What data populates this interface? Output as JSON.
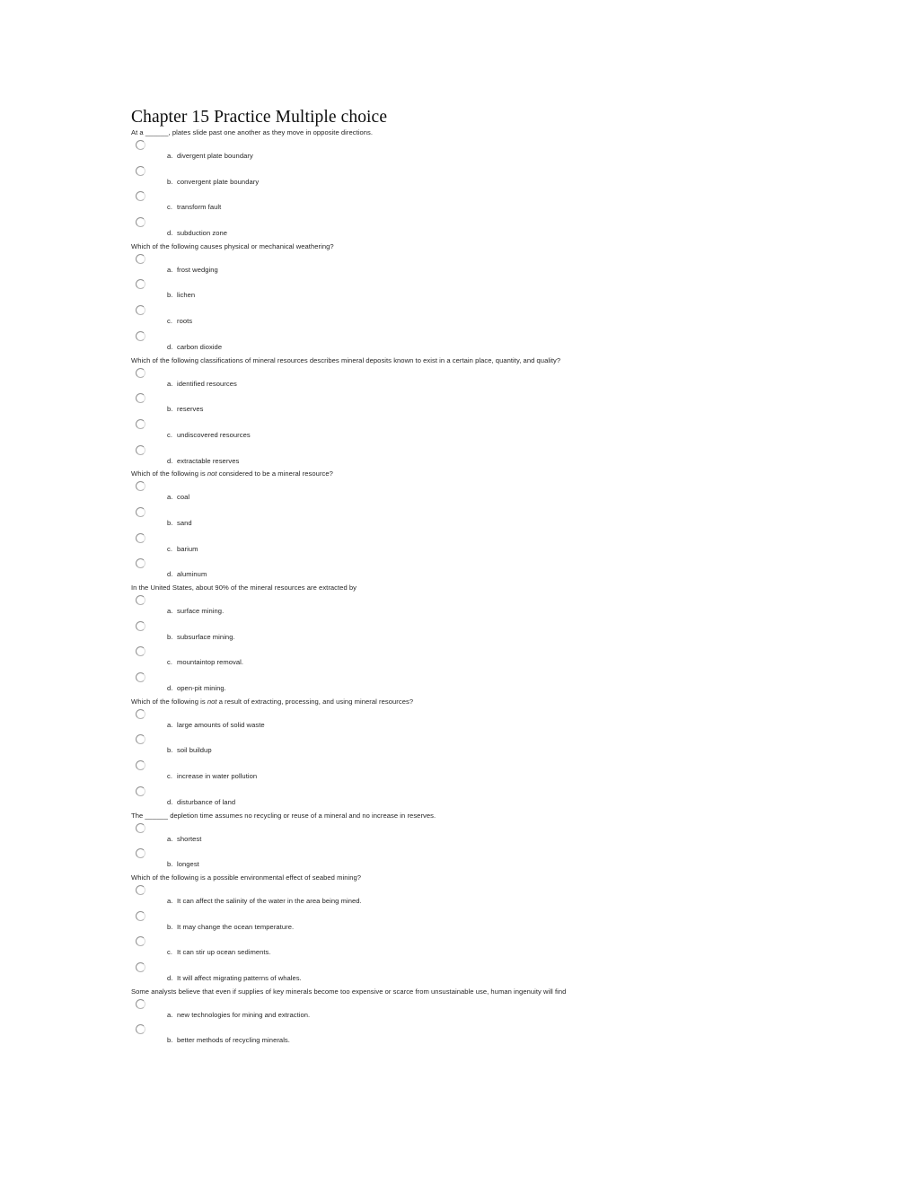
{
  "document": {
    "title": "Chapter 15 Practice Multiple choice",
    "radio_icon": "radio-unchecked-icon",
    "colors": {
      "page_background": "#ffffff",
      "text": "#262626",
      "title": "#0d0d0d",
      "radio_border": "#b0b0b0"
    }
  },
  "questions": [
    {
      "id": "q1",
      "text_parts": [
        {
          "type": "plain",
          "text": "At a ______, plates slide past one another as they move in opposite directions."
        }
      ],
      "options": [
        {
          "letter": "a.",
          "text": "divergent plate boundary"
        },
        {
          "letter": "b.",
          "text": "convergent plate boundary"
        },
        {
          "letter": "c.",
          "text": "transform fault"
        },
        {
          "letter": "d.",
          "text": "subduction zone"
        }
      ]
    },
    {
      "id": "q2",
      "text_parts": [
        {
          "type": "plain",
          "text": "Which of the following causes physical or mechanical weathering?"
        }
      ],
      "options": [
        {
          "letter": "a.",
          "text": "frost wedging"
        },
        {
          "letter": "b.",
          "text": "lichen"
        },
        {
          "letter": "c.",
          "text": "roots"
        },
        {
          "letter": "d.",
          "text": "carbon dioxide"
        }
      ]
    },
    {
      "id": "q3",
      "text_parts": [
        {
          "type": "plain",
          "text": "Which of the following classifications of mineral resources describes mineral deposits known to exist in a certain place, quantity, and quality?"
        }
      ],
      "options": [
        {
          "letter": "a.",
          "text": "identified resources"
        },
        {
          "letter": "b.",
          "text": "reserves"
        },
        {
          "letter": "c.",
          "text": "undiscovered resources"
        },
        {
          "letter": "d.",
          "text": "extractable reserves"
        }
      ]
    },
    {
      "id": "q4",
      "text_parts": [
        {
          "type": "plain",
          "text": "Which of the following is "
        },
        {
          "type": "italic",
          "text": "not"
        },
        {
          "type": "plain",
          "text": " considered to be a mineral resource?"
        }
      ],
      "options": [
        {
          "letter": "a.",
          "text": "coal"
        },
        {
          "letter": "b.",
          "text": "sand"
        },
        {
          "letter": "c.",
          "text": "barium"
        },
        {
          "letter": "d.",
          "text": "aluminum"
        }
      ]
    },
    {
      "id": "q5",
      "text_parts": [
        {
          "type": "plain",
          "text": "In the United States, about 90% of the mineral resources are extracted by"
        }
      ],
      "options": [
        {
          "letter": "a.",
          "text": "surface mining."
        },
        {
          "letter": "b.",
          "text": "subsurface mining."
        },
        {
          "letter": "c.",
          "text": "mountaintop removal."
        },
        {
          "letter": "d.",
          "text": "open-pit mining."
        }
      ]
    },
    {
      "id": "q6",
      "text_parts": [
        {
          "type": "plain",
          "text": "Which of the following is "
        },
        {
          "type": "italic",
          "text": "not"
        },
        {
          "type": "plain",
          "text": " a result of extracting, processing, and using mineral resources?"
        }
      ],
      "options": [
        {
          "letter": "a.",
          "text": "large amounts of solid waste"
        },
        {
          "letter": "b.",
          "text": "soil buildup"
        },
        {
          "letter": "c.",
          "text": "increase in water pollution"
        },
        {
          "letter": "d.",
          "text": "disturbance of land"
        }
      ]
    },
    {
      "id": "q7",
      "text_parts": [
        {
          "type": "plain",
          "text": "The ______ depletion time assumes no recycling or reuse of a mineral and no increase in reserves."
        }
      ],
      "options": [
        {
          "letter": "a.",
          "text": "shortest"
        },
        {
          "letter": "b.",
          "text": "longest"
        }
      ]
    },
    {
      "id": "q8",
      "text_parts": [
        {
          "type": "plain",
          "text": "Which of the following is a possible environmental effect of seabed mining?"
        }
      ],
      "options": [
        {
          "letter": "a.",
          "text": "It can affect the salinity of the water in the area being mined."
        },
        {
          "letter": "b.",
          "text": "It may change the ocean temperature."
        },
        {
          "letter": "c.",
          "text": "It can stir up ocean sediments."
        },
        {
          "letter": "d.",
          "text": "It will affect migrating patterns of whales."
        }
      ]
    },
    {
      "id": "q9",
      "text_parts": [
        {
          "type": "plain",
          "text": "Some analysts believe that even if supplies of key minerals become too expensive or scarce from unsustainable use, human ingenuity will find"
        }
      ],
      "options": [
        {
          "letter": "a.",
          "text": "new technologies for mining and extraction."
        },
        {
          "letter": "b.",
          "text": "better methods of recycling minerals."
        }
      ]
    }
  ]
}
